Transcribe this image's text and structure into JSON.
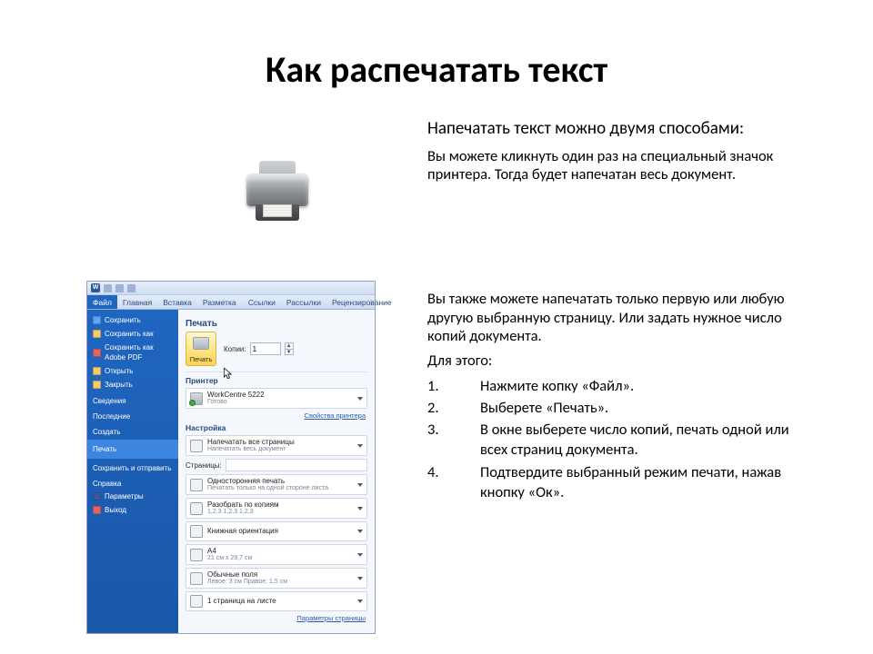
{
  "title": "Как распечатать текст",
  "right": {
    "intro": "Напечатать текст можно двумя способами:",
    "p1": "Вы можете кликнуть один раз на специальный значок принтера. Тогда будет напечатан весь документ.",
    "p2": "Вы также можете напечатать только первую или любую другую выбранную страницу. Или задать нужное число копий документа.",
    "for_this": "Для этого:",
    "steps": [
      "Нажмите копку «Файл».",
      "Выберете «Печать».",
      "В окне выберете число копий, печать одной или всех страниц документа.",
      "Подтвердите выбранный режим печати, нажав кнопку «Ок»."
    ]
  },
  "word": {
    "ribbon": [
      "Файл",
      "Главная",
      "Вставка",
      "Разметка страницы",
      "Ссылки",
      "Рассылки",
      "Рецензирование"
    ],
    "sidebar_top": [
      {
        "label": "Сохранить",
        "ic": "blue"
      },
      {
        "label": "Сохранить как",
        "ic": ""
      },
      {
        "label": "Сохранить как Adobe PDF",
        "ic": "red"
      },
      {
        "label": "Открыть",
        "ic": ""
      },
      {
        "label": "Закрыть",
        "ic": ""
      }
    ],
    "sidebar_groups": [
      "Сведения",
      "Последние",
      "Создать"
    ],
    "sidebar_sel": "Печать",
    "sidebar_after": [
      "Сохранить и отправить",
      "Справка"
    ],
    "sidebar_end": [
      {
        "label": "Параметры",
        "ic": "dark"
      },
      {
        "label": "Выход",
        "ic": "red"
      }
    ],
    "print": {
      "heading": "Печать",
      "btn_label": "Печать",
      "copies_label": "Копии:",
      "copies_value": "1",
      "printer_h": "Принтер",
      "printer_name": "WorkCentre 5222",
      "printer_status": "Готово",
      "printer_props": "Свойства принтера",
      "settings_h": "Настройка",
      "s_allpages_t": "Напечатать все страницы",
      "s_allpages_s": "Напечатать весь документ",
      "pages_label": "Страницы:",
      "s_side_t": "Односторонняя печать",
      "s_side_s": "Печатать только на одной стороне листа",
      "s_collate_t": "Разобрать по копиям",
      "s_collate_s": "1,2,3   1,2,3   1,2,3",
      "s_orient": "Книжная ориентация",
      "s_paper_t": "A4",
      "s_paper_s": "21 см x 29,7 см",
      "s_margins_t": "Обычные поля",
      "s_margins_s": "Левое: 3 см   Правое: 1,5 см",
      "s_nup": "1 страница на листе",
      "page_setup": "Параметры страницы"
    }
  }
}
